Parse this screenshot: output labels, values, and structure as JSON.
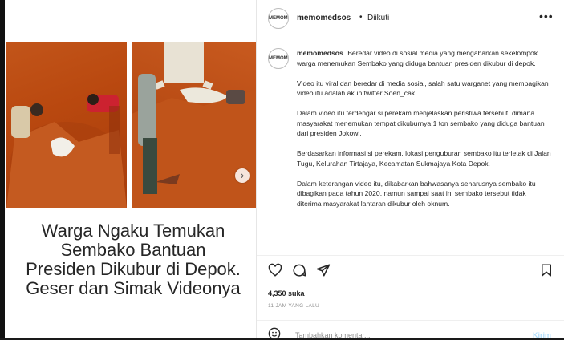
{
  "account": {
    "avatar_text": "MEMOMEDSOS",
    "username": "memomedsos",
    "separator": "•",
    "follow_status": "Diikuti"
  },
  "media": {
    "headline_lines": [
      "Warga Ngaku Temukan",
      "Sembako Bantuan",
      "Presiden Dikubur di Depok.",
      "Geser dan Simak Videonya"
    ],
    "next_icon": "chevron-right-icon"
  },
  "caption": {
    "username": "memomedsos",
    "paragraphs": [
      "Beredar video di sosial media yang mengabarkan sekelompok warga menemukan Sembako yang diduga bantuan presiden dikubur di depok.",
      "Video itu viral dan beredar di media sosial, salah satu warganet yang membagikan video itu adalah akun twitter Soen_cak.",
      "Dalam video itu terdengar si perekam menjelaskan peristiwa tersebut, dimana masyarakat menemukan tempat dikuburnya 1 ton sembako yang diduga bantuan dari presiden Jokowi.",
      "Berdasarkan informasi si perekam, lokasi penguburan sembako itu terletak di Jalan Tugu, Kelurahan Tirtajaya, Kecamatan Sukmajaya Kota Depok.",
      "Dalam keterangan video itu, dikabarkan bahwasanya seharusnya sembako itu dibagikan pada tahun 2020, namun sampai saat ini sembako tersebut tidak diterima masyarakat lantaran dikubur oleh oknum."
    ]
  },
  "actions": {
    "like_icon": "heart-icon",
    "comment_icon": "comment-icon",
    "share_icon": "send-icon",
    "save_icon": "bookmark-icon"
  },
  "stats": {
    "likes": "4,350 suka",
    "time_ago": "11 JAM YANG LALU"
  },
  "comment": {
    "placeholder": "Tambahkan komentar...",
    "post_label": "Kirim",
    "emoji_icon": "smiley-icon"
  },
  "colors": {
    "soil": "#b84b14",
    "text": "#262626",
    "muted": "#8e8e8e",
    "post_disabled": "#b2dffc"
  }
}
